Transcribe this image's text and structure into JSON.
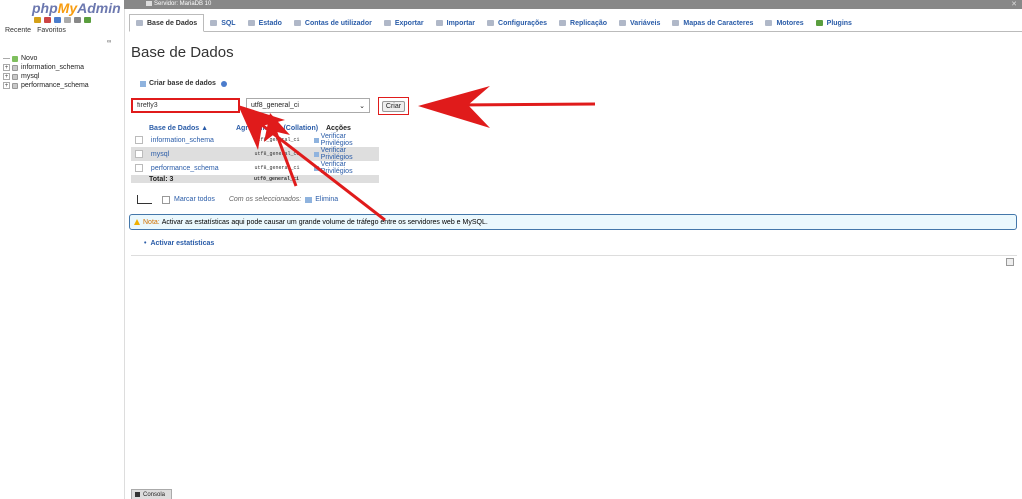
{
  "navigation": {
    "logo_php": "php",
    "logo_my": "My",
    "logo_admin": "Admin",
    "recent": "Recente",
    "favorites": "Favoritos",
    "tree": [
      "Novo",
      "information_schema",
      "mysql",
      "performance_schema"
    ]
  },
  "server_bar": {
    "title": "Servidor: MariaDB 10"
  },
  "tabs": [
    {
      "label": "Base de Dados",
      "active": true
    },
    {
      "label": "SQL"
    },
    {
      "label": "Estado"
    },
    {
      "label": "Contas de utilizador"
    },
    {
      "label": "Exportar"
    },
    {
      "label": "Importar"
    },
    {
      "label": "Configurações"
    },
    {
      "label": "Replicação"
    },
    {
      "label": "Variáveis"
    },
    {
      "label": "Mapas de Caracteres"
    },
    {
      "label": "Motores"
    },
    {
      "label": "Plugins"
    }
  ],
  "main": {
    "title": "Base de Dados",
    "create_label": "Criar base de dados",
    "db_name_value": "firefly3",
    "collation_value": "utf8_general_ci",
    "create_button": "Criar",
    "table": {
      "headers": [
        "Base de Dados",
        "Agrupamento (Collation)",
        "Acções"
      ],
      "rows": [
        {
          "name": "information_schema",
          "collation": "utf8_general_ci",
          "action": "Verificar Privilégios"
        },
        {
          "name": "mysql",
          "collation": "utf8_general_ci",
          "action": "Verificar Privilégios"
        },
        {
          "name": "performance_schema",
          "collation": "utf8_general_ci",
          "action": "Verificar Privilégios"
        }
      ],
      "total_label": "Total: 3",
      "total_collation": "utf8_general_ci"
    },
    "bulk": {
      "mark_all": "Marcar todos",
      "with_selected": "Com os seleccionados:",
      "drop": "Elimina"
    },
    "notice_label": "Nota:",
    "notice_text": "Activar as estatísticas aqui pode causar um grande volume de tráfego entre os servidores web e MySQL.",
    "stats_link": "Activar estatísticas"
  },
  "console": "Consola",
  "colors": {
    "accent": "#2a5ca8",
    "highlight": "#e01b1b"
  }
}
